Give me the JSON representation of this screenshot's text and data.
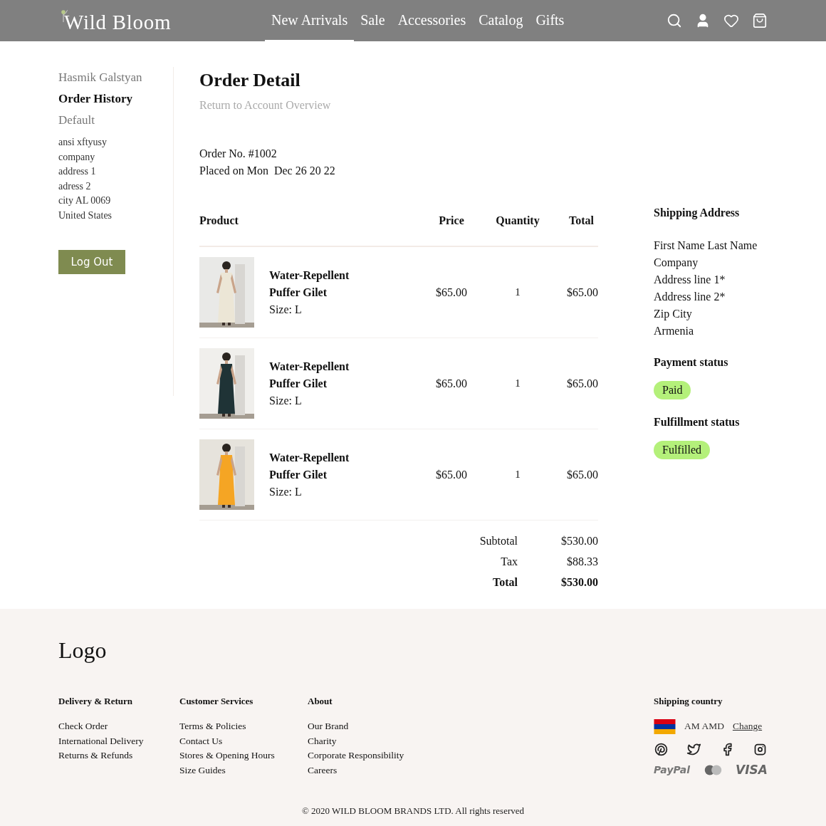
{
  "header": {
    "logo": "Wild Bloom",
    "nav": [
      {
        "label": "New Arrivals",
        "selected": true
      },
      {
        "label": "Sale",
        "selected": false
      },
      {
        "label": "Accessories",
        "selected": false
      },
      {
        "label": "Catalog",
        "selected": false
      },
      {
        "label": "Gifts",
        "selected": false
      }
    ]
  },
  "sidebar": {
    "items": [
      {
        "label": "Hasmik Galstyan",
        "selected": false
      },
      {
        "label": "Order History",
        "selected": true
      },
      {
        "label": "Default",
        "selected": false
      }
    ],
    "address": [
      "ansi xftyusy",
      "company",
      "address 1",
      "adress 2",
      "city AL 0069",
      "United States"
    ],
    "logout_button": "Log Out"
  },
  "order": {
    "title": "Order Detail",
    "back_link": "Return to Account Overview",
    "number": "Order No. #1002",
    "placed": "Placed on Mon  Dec 26 20 22",
    "columns": [
      "Product",
      "Price",
      "Quantity",
      "Total"
    ],
    "items": [
      {
        "name": "Water-Repellent Puffer Gilet",
        "size": "Size: L",
        "price": "$65.00",
        "quantity": "1",
        "total": "$65.00"
      },
      {
        "name": "Water-Repellent Puffer Gilet",
        "size": "Size: L",
        "price": "$65.00",
        "quantity": "1",
        "total": "$65.00"
      },
      {
        "name": "Water-Repellent Puffer Gilet",
        "size": "Size: L",
        "price": "$65.00",
        "quantity": "1",
        "total": "$65.00"
      }
    ],
    "summary": [
      {
        "label": "Subtotal",
        "value": "$530.00",
        "bold": false
      },
      {
        "label": "Tax",
        "value": "$88.33",
        "bold": false
      },
      {
        "label": "Total",
        "value": "$530.00",
        "bold": true
      }
    ]
  },
  "shipping": {
    "title": "Shipping Address",
    "lines": [
      "First Name Last Name",
      "Company",
      "Address line 1*",
      "Address line 2*",
      "Zip City",
      "Armenia"
    ],
    "payment_title": "Payment status",
    "payment_status": "Paid",
    "fulfillment_title": "Fulfillment status",
    "fulfillment_status": "Fulfilled"
  },
  "footer": {
    "logo": "Logo",
    "columns": [
      {
        "title": "Delivery & Return",
        "links": [
          "Check Order",
          "International Delivery",
          "Returns & Refunds"
        ]
      },
      {
        "title": "Customer Services",
        "links": [
          "Terms & Policies",
          "Contact Us",
          "Stores & Opening Hours",
          "Size Guides"
        ]
      },
      {
        "title": "About",
        "links": [
          "Our Brand",
          "Charity",
          "Corporate Responsibility",
          "Careers"
        ]
      }
    ],
    "shipping_country": {
      "title": "Shipping country",
      "currency": "AM AMD",
      "change_link": "Change"
    },
    "payments": [
      "PayPal",
      "VISA"
    ],
    "copyright": "© 2020 WILD BLOOM BRANDS LTD. All rights reserved"
  }
}
